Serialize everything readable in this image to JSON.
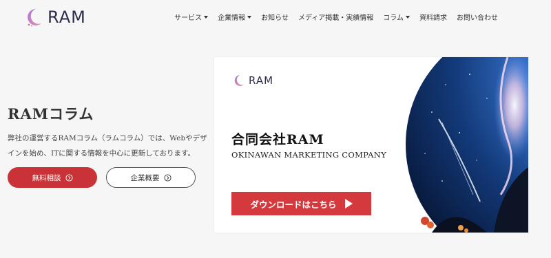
{
  "header": {
    "logo_text": "RAM",
    "nav": [
      {
        "label": "サービス",
        "has_dropdown": true
      },
      {
        "label": "企業情報",
        "has_dropdown": true
      },
      {
        "label": "お知らせ",
        "has_dropdown": false
      },
      {
        "label": "メディア掲載・実績情報",
        "has_dropdown": false
      },
      {
        "label": "コラム",
        "has_dropdown": true
      },
      {
        "label": "資料請求",
        "has_dropdown": false
      },
      {
        "label": "お問い合わせ",
        "has_dropdown": false
      }
    ]
  },
  "hero": {
    "title": "RAMコラム",
    "description": "弊社の運営するRAMコラム（ラムコラム）では、Webやデザインを始め、ITに関する情報を中心に更新しております。",
    "primary_button": "無料相談",
    "secondary_button": "企業概要"
  },
  "banner": {
    "logo_text": "RAM",
    "title": "合同会社RAM",
    "subtitle": "OKINAWAN MARKETING COMPANY",
    "download_button": "ダウンロードはこちら"
  },
  "colors": {
    "accent_red": "#c93236",
    "logo_purple": "#8a5aa8",
    "background": "#f6f6f6"
  },
  "icons": {
    "logo": "crescent-moon-icon",
    "dropdown": "caret-down-icon",
    "button_arrow": "circle-arrow-right-icon",
    "download_arrow": "play-arrow-icon"
  }
}
